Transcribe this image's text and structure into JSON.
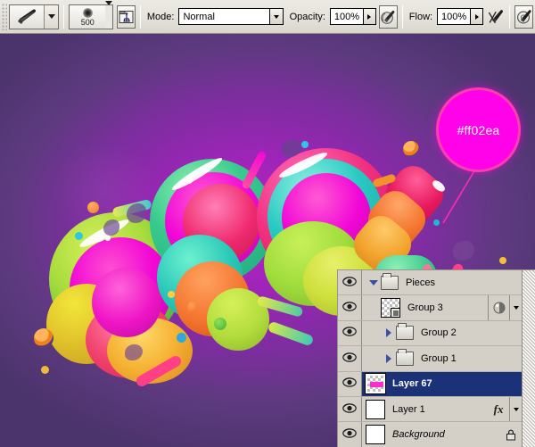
{
  "options_bar": {
    "tool_icon": "paintbrush-icon",
    "tool_preset_caret": "chevron-down-icon",
    "brush_size": "500",
    "brush_preset_caret": "chevron-down-icon",
    "brushes_palette_icon": "brushes-palette-icon",
    "mode_label": "Mode:",
    "mode_value": "Normal",
    "opacity_label": "Opacity:",
    "opacity_value": "100%",
    "opacity_pressure_icon": "airbrush-pressure-icon",
    "flow_label": "Flow:",
    "flow_value": "100%",
    "flow_pressure_icon": "flow-pressure-icon",
    "airbrush_icon": "airbrush-icon"
  },
  "canvas": {
    "swatch": {
      "hex_label": "#ff02ea",
      "fill_color": "#ff02ea",
      "ring_color": "#ff3bb0",
      "leader_color": "#ff2ab5"
    },
    "background_colors": {
      "outer": "#4b336c",
      "mid": "#7e2da0",
      "inner": "#b726c4",
      "bottom": "#3c2b5c"
    },
    "artwork_palette": {
      "magenta": "#f207d6",
      "pink": "#ff2f8f",
      "crimson": "#e81a5e",
      "orange": "#f98b2e",
      "yellow": "#f4d22a",
      "lime": "#c4e82a",
      "green": "#56c94a",
      "teal": "#29c9b8",
      "cyan": "#22b7e0",
      "violet": "#6f4b8e"
    }
  },
  "layers_panel": {
    "scrollbar_name": "panel-scrollbar",
    "rows": [
      {
        "name": "Pieces",
        "type": "group",
        "twisty": "expanded",
        "indent": 0,
        "visible": true,
        "selected": false,
        "thumb": "folder",
        "right_icons": []
      },
      {
        "name": "Group 3",
        "type": "layer",
        "twisty": "none",
        "indent": 1,
        "visible": true,
        "selected": false,
        "thumb": "checker-group",
        "right_icons": [
          "adjustment-icon",
          "chevron-down-icon"
        ]
      },
      {
        "name": "Group 2",
        "type": "group",
        "twisty": "collapsed",
        "indent": 1,
        "visible": true,
        "selected": false,
        "thumb": "folder",
        "right_icons": []
      },
      {
        "name": "Group 1",
        "type": "group",
        "twisty": "collapsed",
        "indent": 1,
        "visible": true,
        "selected": false,
        "thumb": "folder",
        "right_icons": []
      },
      {
        "name": "Layer 67",
        "type": "layer",
        "twisty": "none",
        "indent": 0,
        "visible": true,
        "selected": true,
        "thumb": "checker-pink",
        "right_icons": []
      },
      {
        "name": "Layer 1",
        "type": "layer",
        "twisty": "none",
        "indent": 0,
        "visible": true,
        "selected": false,
        "thumb": "white",
        "right_icons": [
          "fx-icon",
          "chevron-down-icon"
        ]
      },
      {
        "name": "Background",
        "type": "layer",
        "twisty": "none",
        "indent": 0,
        "visible": true,
        "selected": false,
        "thumb": "white",
        "italic": true,
        "right_icons": [
          "lock-icon"
        ]
      }
    ]
  }
}
